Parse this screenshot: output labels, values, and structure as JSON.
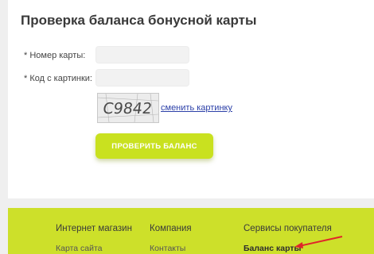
{
  "form": {
    "title": "Проверка баланса бонусной карты",
    "card_number_label": "* Номер карты:",
    "card_number_value": "",
    "captcha_label": "* Код с картинки:",
    "captcha_value": "",
    "captcha_text": "C9842",
    "change_captcha_link": "сменить картинку",
    "submit_label": "ПРОВЕРИТЬ БАЛАНС"
  },
  "footer": {
    "columns": [
      {
        "heading": "Интернет магазин",
        "link": "Карта сайта"
      },
      {
        "heading": "Компания",
        "link": "Контакты"
      },
      {
        "heading": "Сервисы покупателя",
        "link": "Баланс карты"
      }
    ]
  },
  "colors": {
    "accent": "#c9e11f",
    "footer_bg": "#cde02a",
    "arrow": "#e0262a",
    "link": "#2b3fa8"
  }
}
